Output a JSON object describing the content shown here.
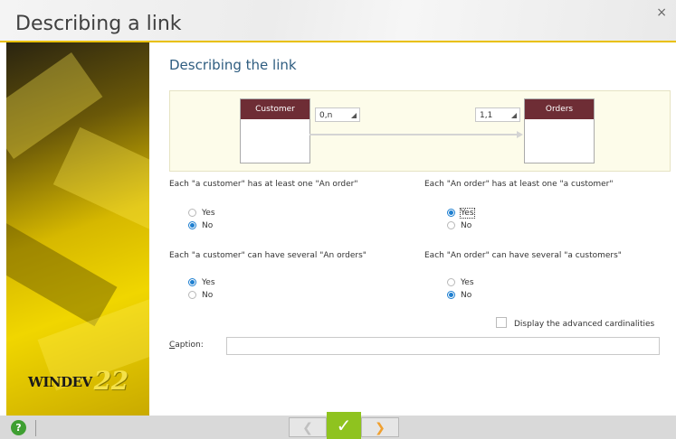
{
  "window": {
    "title": "Describing a link",
    "close_glyph": "×"
  },
  "branding": {
    "logo_text": "WINDEV",
    "logo_number": "22"
  },
  "page": {
    "heading": "Describing the link"
  },
  "diagram": {
    "left_table": "Customer",
    "right_table": "Orders",
    "left_cardinality": "0,n",
    "right_cardinality": "1,1",
    "header_color": "#6e2d35"
  },
  "questions": {
    "q1": {
      "text": "Each \"a customer\" has at least one \"An order\"",
      "yes": "Yes",
      "no": "No",
      "selected": "No"
    },
    "q2": {
      "text": "Each \"An order\" has at least one \"a customer\"",
      "yes": "Yes",
      "no": "No",
      "selected": "Yes"
    },
    "q3": {
      "text": "Each \"a customer\" can have several \"An orders\"",
      "yes": "Yes",
      "no": "No",
      "selected": "Yes"
    },
    "q4": {
      "text": "Each \"An order\" can have several \"a customers\"",
      "yes": "Yes",
      "no": "No",
      "selected": "No"
    }
  },
  "options": {
    "advanced_label": "Display the advanced cardinalities",
    "advanced_checked": false
  },
  "caption": {
    "label_u": "C",
    "label_rest": "aption:",
    "value": ""
  },
  "footer": {
    "help_glyph": "?",
    "prev_glyph": "❮",
    "ok_glyph": "✓",
    "next_glyph": "❯"
  },
  "colors": {
    "accent": "#1e7fd0",
    "ok": "#8fc31f",
    "help": "#3f9f32",
    "gold": "#e9c000"
  }
}
